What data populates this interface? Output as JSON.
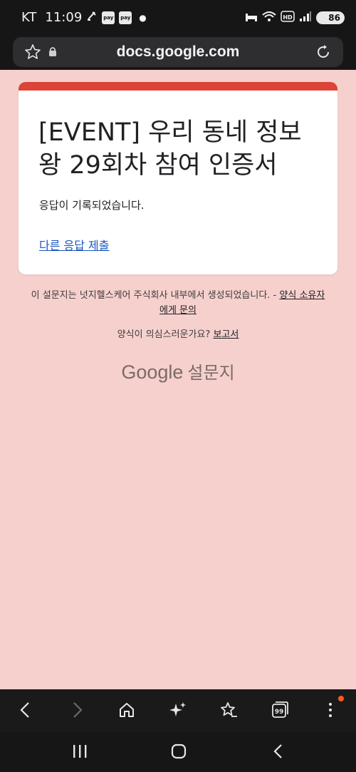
{
  "status_bar": {
    "carrier": "KT",
    "time": "11:09",
    "pay_badges": [
      "pay",
      "pay"
    ],
    "battery": "86",
    "icons": [
      "signature-icon",
      "dot-icon",
      "sleep-icon",
      "wifi-icon",
      "hd-icon",
      "signal-icon",
      "battery-icon"
    ]
  },
  "browser": {
    "url": "docs.google.com",
    "icons": [
      "star-icon",
      "lock-icon",
      "reload-icon"
    ]
  },
  "form": {
    "accent_color": "#db4437",
    "title": "[EVENT] 우리 동네 정보왕 29회차 참여 인증서",
    "response_message": "응답이 기록되었습니다.",
    "submit_another_link": "다른 응답 제출"
  },
  "footer": {
    "created_text": "이 설문지는 넛지헬스케어 주식회사 내부에서 생성되었습니다. - ",
    "contact_link": "양식 소유자에게 문의",
    "suspicious_text": "양식이 의심스러운가요? ",
    "report_link": "보고서",
    "brand_google": "Google",
    "brand_forms": "설문지"
  },
  "bottom_nav": {
    "items": [
      "back-icon",
      "forward-icon",
      "home-icon",
      "sparkle-icon",
      "bookmark-star-icon",
      "tabs-icon",
      "more-icon"
    ],
    "tabs_count": "99"
  },
  "system_nav": {
    "items": [
      "recents-icon",
      "home-circle-icon",
      "system-back-icon"
    ]
  },
  "colors": {
    "page_bg": "#f6d0cd",
    "link": "#1a57c2",
    "notification": "#ff5a1f"
  }
}
